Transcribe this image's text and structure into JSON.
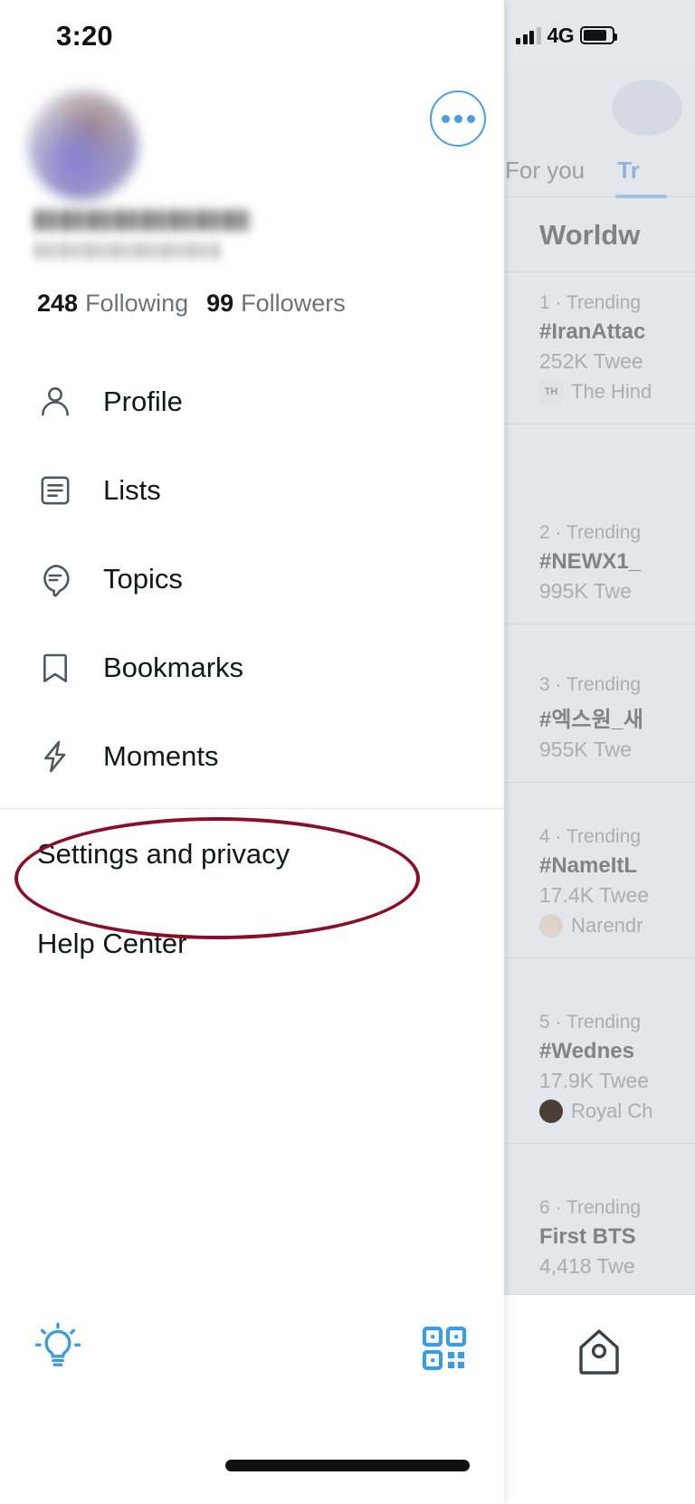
{
  "status_bar": {
    "time": "3:20",
    "network_label": "4G",
    "signal_icon": "signal-bars-icon",
    "battery_icon": "battery-icon"
  },
  "drawer": {
    "more_options_icon": "more-options-icon",
    "avatar_icon": "avatar-blurred",
    "profile_name_redacted": "",
    "profile_handle_redacted": "",
    "stats": {
      "following_count": "248",
      "following_label": "Following",
      "followers_count": "99",
      "followers_label": "Followers"
    },
    "menu_items": [
      {
        "label": "Profile",
        "icon": "person-icon"
      },
      {
        "label": "Lists",
        "icon": "list-document-icon"
      },
      {
        "label": "Topics",
        "icon": "speech-bubble-icon"
      },
      {
        "label": "Bookmarks",
        "icon": "bookmark-icon"
      },
      {
        "label": "Moments",
        "icon": "lightning-bolt-icon"
      }
    ],
    "secondary_items": [
      {
        "label": "Settings and privacy",
        "highlighted": true
      },
      {
        "label": "Help Center",
        "highlighted": false
      }
    ],
    "bottom_bar": {
      "left_icon": "lightbulb-icon",
      "right_icon": "qr-code-icon"
    }
  },
  "annotation": {
    "shape": "ellipse",
    "color": "#8a0f26",
    "target_label": "Settings and privacy"
  },
  "background_panel": {
    "tabs": [
      {
        "label": "For you",
        "active": false
      },
      {
        "label": "Tr",
        "active": true
      }
    ],
    "section_header": "Worldw",
    "trends": [
      {
        "rank": "1 · Trending",
        "name": "#IranAttac",
        "count": "252K Twee",
        "source": "The Hind",
        "source_icon": "the-hindu-logo"
      },
      {
        "rank": "2 · Trending",
        "name": "#NEWX1_",
        "count": "995K Twe",
        "source": "",
        "source_icon": ""
      },
      {
        "rank": "3 · Trending",
        "name": "#엑스원_새",
        "count": "955K Twe",
        "source": "",
        "source_icon": ""
      },
      {
        "rank": "4 · Trending",
        "name": "#NameItL",
        "count": "17.4K Twee",
        "source": "Narendr",
        "source_icon": "narendra-modi-avatar"
      },
      {
        "rank": "5 · Trending",
        "name": "#Wednes",
        "count": "17.9K Twee",
        "source": "Royal Ch",
        "source_icon": "royal-channel-avatar"
      },
      {
        "rank": "6 · Trending",
        "name": "First BTS",
        "count": "4,418 Twe",
        "source": "",
        "source_icon": ""
      }
    ],
    "bottom_nav_icon": "home-icon"
  }
}
